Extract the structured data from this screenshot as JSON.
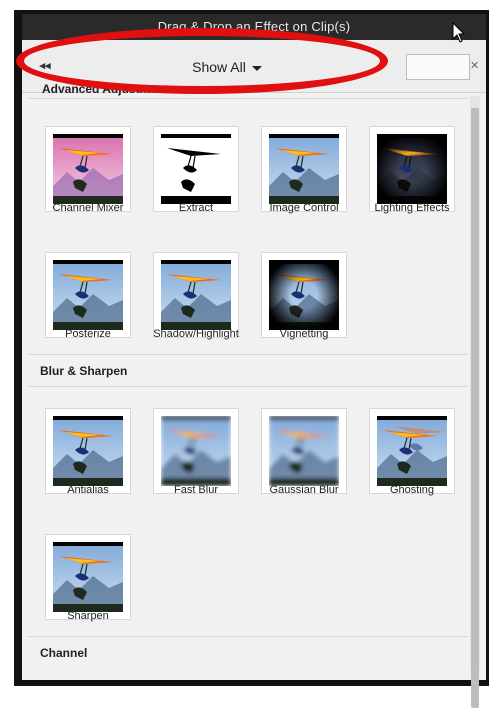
{
  "window": {
    "title": "Drag & Drop an Effect on Clip(s)"
  },
  "toolbar": {
    "filter_label": "Show All",
    "collapse_icon": "double-chevron-left-icon"
  },
  "sections": [
    {
      "title": "Advanced Adjustments",
      "items": [
        {
          "label": "Channel Mixer",
          "style": "pink"
        },
        {
          "label": "Extract",
          "style": "bw"
        },
        {
          "label": "Image Control",
          "style": "normal"
        },
        {
          "label": "Lighting Effects",
          "style": "dark"
        },
        {
          "label": "Posterize",
          "style": "normal"
        },
        {
          "label": "Shadow/Highlight",
          "style": "normal"
        },
        {
          "label": "Vignetting",
          "style": "vignette"
        }
      ]
    },
    {
      "title": "Blur & Sharpen",
      "items": [
        {
          "label": "Antialias",
          "style": "normal"
        },
        {
          "label": "Fast Blur",
          "style": "blur"
        },
        {
          "label": "Gaussian Blur",
          "style": "blur"
        },
        {
          "label": "Ghosting",
          "style": "ghost"
        },
        {
          "label": "Sharpen",
          "style": "normal"
        }
      ]
    },
    {
      "title": "Channel",
      "items": []
    }
  ],
  "colors": {
    "highlight_oval": "#e01010",
    "titlebar": "#2a2a2a",
    "panel": "#f1f1f1"
  }
}
